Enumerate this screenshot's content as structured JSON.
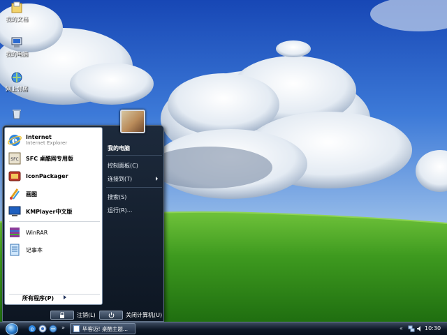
{
  "desktop": {
    "icons": [
      {
        "label": "我的文档",
        "icon": "folder-icon"
      },
      {
        "label": "我的电脑",
        "icon": "computer-icon"
      },
      {
        "label": "网上邻居",
        "icon": "network-icon"
      },
      {
        "label": "",
        "icon": "recycle-bin-icon"
      }
    ]
  },
  "start_menu": {
    "programs": [
      {
        "name": "Internet",
        "sub": "Internet Explorer",
        "icon": "ie-icon"
      },
      {
        "name": "SFC 桌酷网专用版",
        "sub": "",
        "icon": "sfc-icon"
      },
      {
        "name": "IconPackager",
        "sub": "",
        "icon": "iconpackager-icon"
      },
      {
        "name": "画图",
        "sub": "",
        "icon": "paint-icon"
      },
      {
        "name": "KMPlayer中文版",
        "sub": "",
        "icon": "kmplayer-icon"
      },
      {
        "name": "WinRAR",
        "sub": "",
        "icon": "winrar-icon"
      },
      {
        "name": "记事本",
        "sub": "",
        "icon": "notepad-icon"
      }
    ],
    "all_programs": "所有程序(P)",
    "right_items": [
      {
        "label": "我的电脑"
      },
      {
        "label": "控制面板(C)"
      },
      {
        "label": "连接到(T)"
      },
      {
        "label": "搜索(S)"
      },
      {
        "label": "运行(R)..."
      }
    ],
    "logoff": "注销(L)",
    "shutdown": "关闭计算机(U)"
  },
  "taskbar": {
    "task_label": "毕客迈! 桌酷主题...",
    "clock": "10:30",
    "tray_arrow": "«"
  }
}
